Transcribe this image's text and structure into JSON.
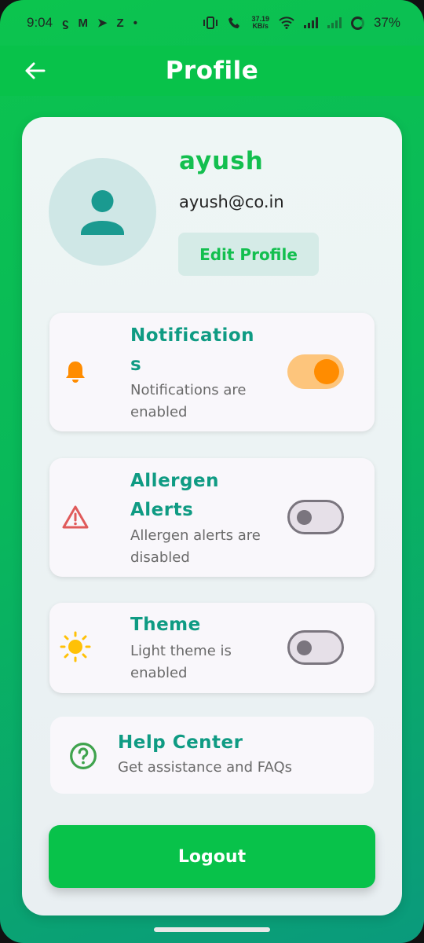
{
  "status_bar": {
    "time": "9:04",
    "left_glyphs": [
      "ϛ",
      "M",
      "➤",
      "Z",
      "•"
    ],
    "speed_value": "37.19",
    "speed_unit": "KB/s",
    "battery": "37%"
  },
  "app_bar": {
    "title": "Profile",
    "back_icon": "arrow-left-icon"
  },
  "profile": {
    "name": "ayush",
    "email": "ayush@co.in",
    "edit_label": "Edit Profile",
    "avatar_icon": "person-icon"
  },
  "settings": [
    {
      "id": "notifications",
      "title": "Notification\ns",
      "subtitle": "Notifications are enabled",
      "icon": "bell-icon",
      "enabled": true
    },
    {
      "id": "allergen",
      "title": "Allergen Alerts",
      "subtitle": "Allergen alerts are disabled",
      "icon": "warning-icon",
      "enabled": false
    },
    {
      "id": "theme",
      "title": "Theme",
      "subtitle": "Light theme is enabled",
      "icon": "sun-icon",
      "enabled": false
    }
  ],
  "help": {
    "title": "Help Center",
    "subtitle": "Get assistance and FAQs",
    "icon": "help-circle-icon"
  },
  "logout_label": "Logout",
  "colors": {
    "primary_green": "#08c24a",
    "teal_text": "#0f9b83",
    "toggle_on_track": "#fdc57c",
    "toggle_on_knob": "#ff8c00",
    "bell_orange": "#ff8c00",
    "warning_red": "#e05a5a",
    "sun_yellow": "#ffc107",
    "help_green": "#3fa34d"
  }
}
